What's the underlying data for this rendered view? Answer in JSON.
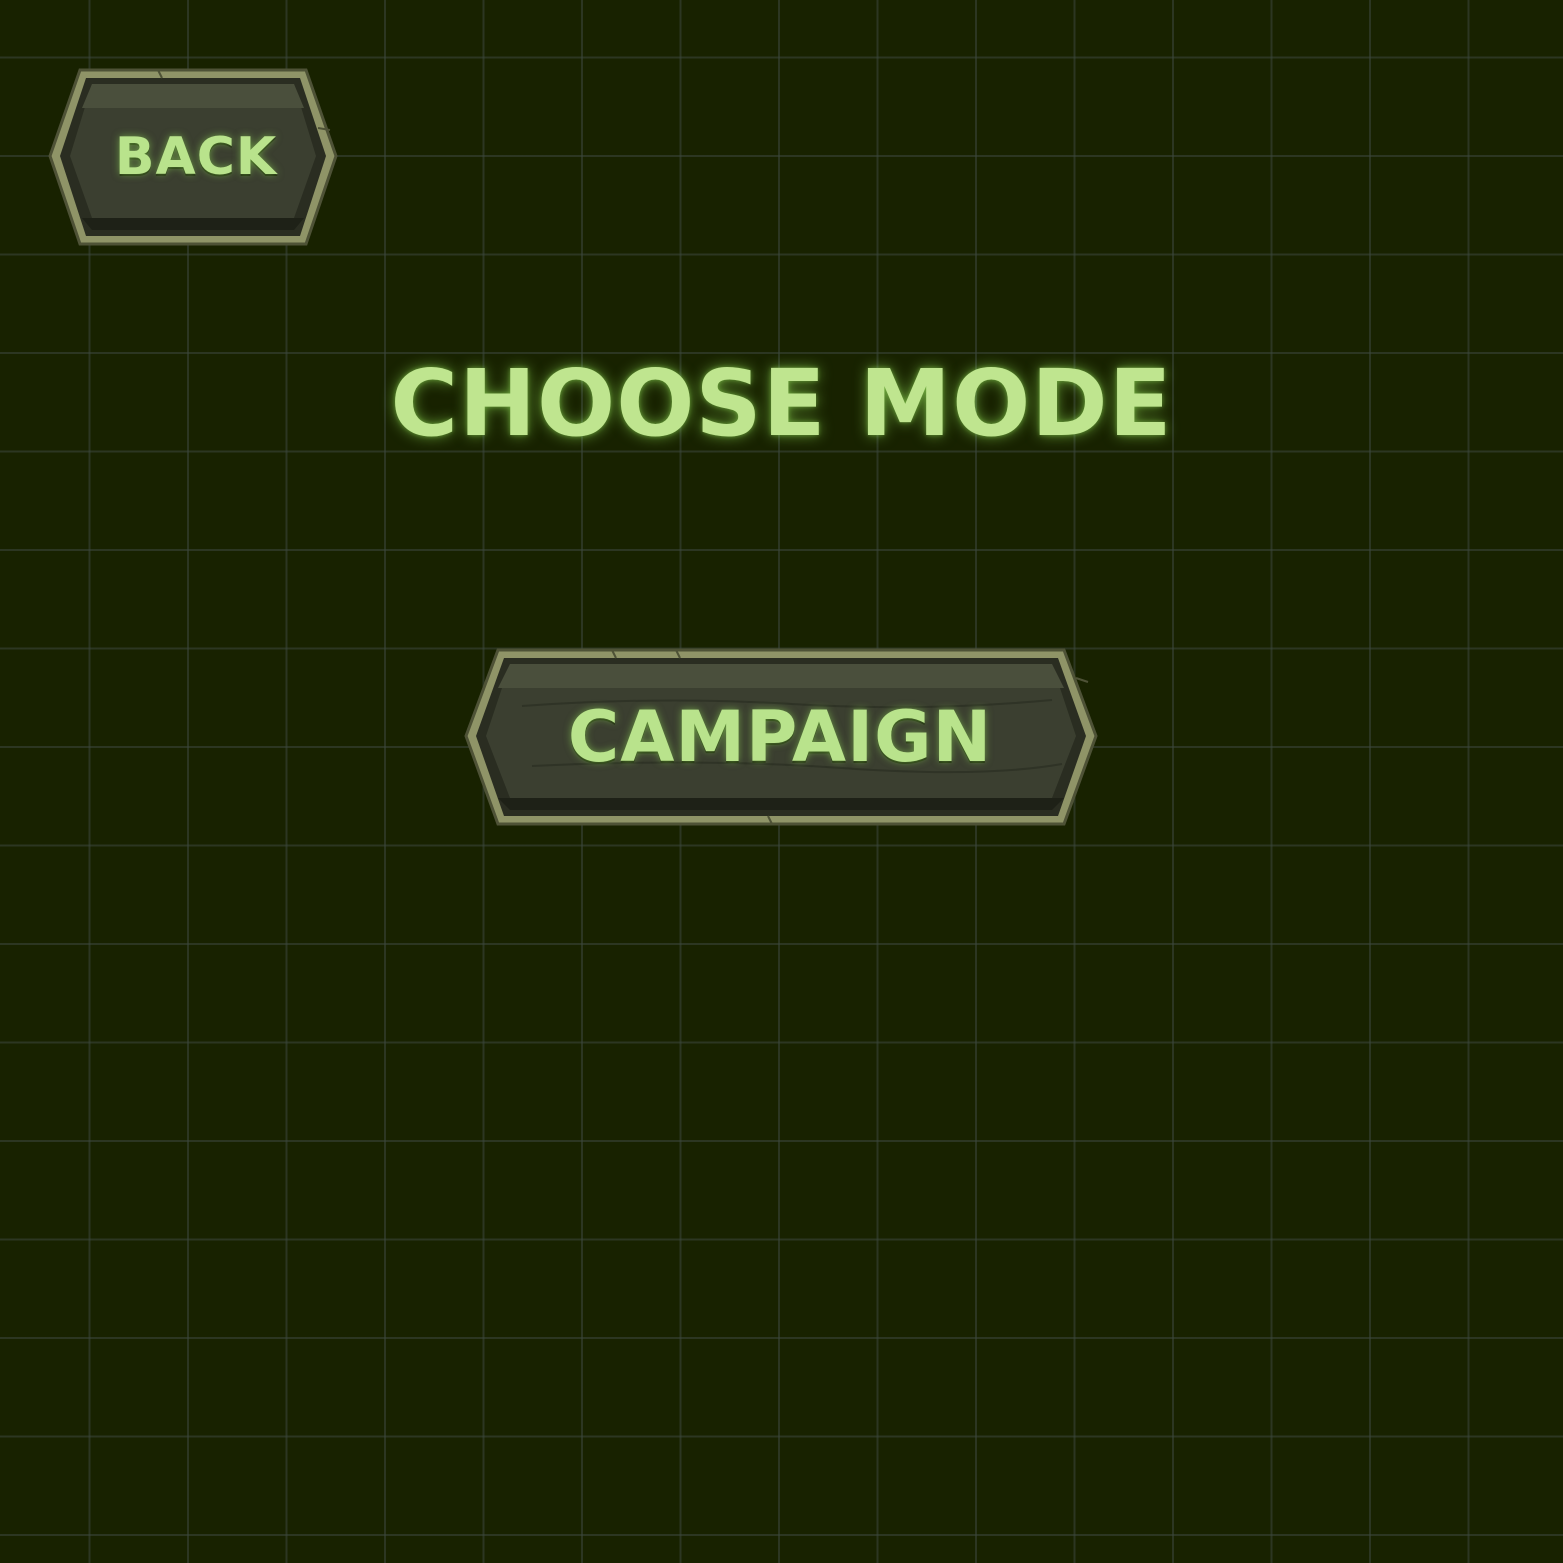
{
  "screen": {
    "title": "CHOOSE MODE"
  },
  "buttons": {
    "back_label": "BACK",
    "campaign_label": "CAMPAIGN"
  },
  "colors": {
    "background": "#182200",
    "grid": "#3c483e",
    "text": "#bfe58f",
    "stone_frame": "#9c9e6f",
    "stone_face": "#363a2b"
  }
}
